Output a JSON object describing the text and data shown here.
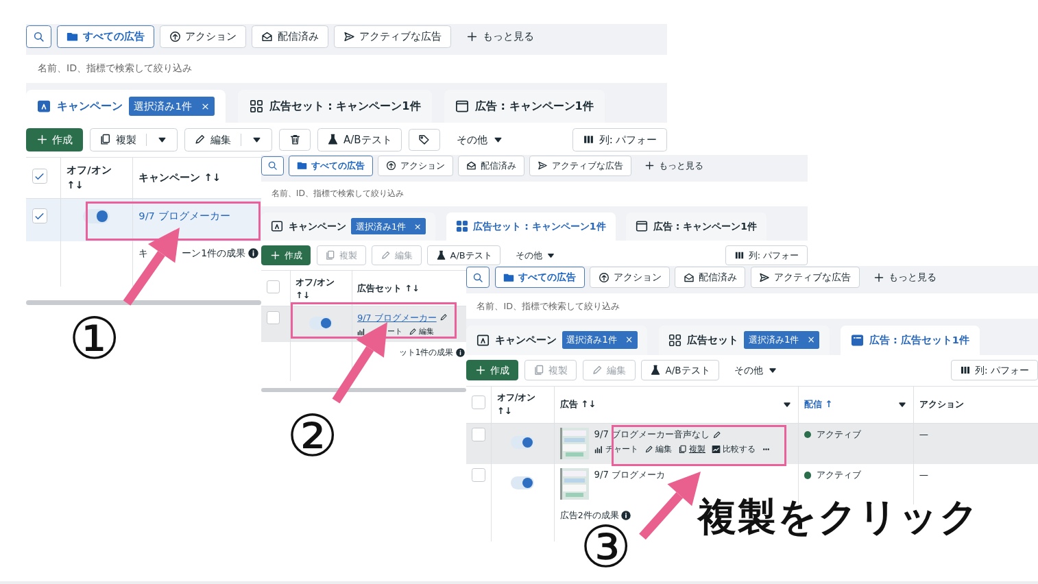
{
  "panels": [
    {
      "filters": [
        {
          "kind": "search"
        },
        {
          "kind": "all",
          "label": "すべての広告",
          "selected": true
        },
        {
          "kind": "action",
          "label": "アクション",
          "selected": false
        },
        {
          "kind": "delivered",
          "label": "配信済み",
          "selected": false
        },
        {
          "kind": "active",
          "label": "アクティブな広告",
          "selected": false
        },
        {
          "kind": "more",
          "label": "もっと見る"
        }
      ],
      "search": {
        "placeholder": "名前、ID、指標で検索して絞り込み"
      },
      "tabs": [
        {
          "kind": "campaign",
          "label": "キャンペーン",
          "badge": "選択済み1件",
          "close": "×",
          "selected": true
        },
        {
          "kind": "adset",
          "label": "広告セット : キャンペーン1件",
          "selected": false
        },
        {
          "kind": "ad",
          "label": "広告 : キャンペーン1件",
          "selected": false
        }
      ],
      "toolbar": [
        {
          "kind": "create",
          "label": "作成",
          "disabled": false
        },
        {
          "kind": "copy",
          "label": "複製",
          "split": true,
          "disabled": false
        },
        {
          "kind": "edit",
          "label": "編集",
          "split": true,
          "disabled": false
        },
        {
          "kind": "delete",
          "disabled": false
        },
        {
          "kind": "abtest",
          "label": "A/Bテスト",
          "disabled": false
        },
        {
          "kind": "tag",
          "disabled": false
        },
        {
          "kind": "other",
          "label": "その他",
          "disabled": false
        },
        {
          "kind": "columns",
          "label": "列: パフォー",
          "disabled": false
        }
      ],
      "table": {
        "checked": true,
        "columns": [
          {
            "kind": "toggle",
            "label": "オフ/オン ↑↓"
          },
          {
            "kind": "name",
            "label": "キャンペーン ↑↓"
          }
        ],
        "rows": [
          {
            "checked": true,
            "hovered": false,
            "on": true,
            "name": "9/7 ブログメーカー"
          }
        ],
        "summary": [
          "キ",
          "ーン1件の成果"
        ]
      }
    },
    {
      "filters": [
        {
          "kind": "search"
        },
        {
          "kind": "all",
          "label": "すべての広告",
          "selected": true
        },
        {
          "kind": "action",
          "label": "アクション",
          "selected": false
        },
        {
          "kind": "delivered",
          "label": "配信済み",
          "selected": false
        },
        {
          "kind": "active",
          "label": "アクティブな広告",
          "selected": false
        },
        {
          "kind": "more",
          "label": "もっと見る"
        }
      ],
      "search": {
        "placeholder": "名前、ID、指標で検索して絞り込み"
      },
      "tabs": [
        {
          "kind": "campaign",
          "label": "キャンペーン",
          "badge": "選択済み1件",
          "close": "×",
          "selected": false
        },
        {
          "kind": "adset",
          "label": "広告セット : キャンペーン1件",
          "selected": true
        },
        {
          "kind": "ad",
          "label": "広告 : キャンペーン1件",
          "selected": false
        }
      ],
      "toolbar": [
        {
          "kind": "create",
          "label": "作成",
          "disabled": false
        },
        {
          "kind": "copy",
          "label": "複製",
          "disabled": true
        },
        {
          "kind": "edit",
          "label": "編集",
          "disabled": true
        },
        {
          "kind": "abtest",
          "label": "A/Bテスト",
          "disabled": false
        },
        {
          "kind": "other",
          "label": "その他",
          "disabled": false
        },
        {
          "kind": "columns",
          "label": "列: パフォー",
          "disabled": false
        }
      ],
      "table": {
        "checked": false,
        "columns": [
          {
            "kind": "toggle",
            "label": "オフ/オン ↑↓"
          },
          {
            "kind": "name",
            "label": "広告セット ↑↓"
          }
        ],
        "rows": [
          {
            "checked": false,
            "hovered": true,
            "on": true,
            "name": "9/7 ブログメーカー",
            "actions": [
              {
                "kind": "chart",
                "label": "ート",
                "hovered": false
              },
              {
                "kind": "edit",
                "label": "編集",
                "hovered": false
              }
            ]
          }
        ],
        "summary": [
          "ット1件の成果"
        ]
      }
    },
    {
      "filters": [
        {
          "kind": "search"
        },
        {
          "kind": "all",
          "label": "すべての広告",
          "selected": true
        },
        {
          "kind": "action",
          "label": "アクション",
          "selected": false
        },
        {
          "kind": "delivered",
          "label": "配信済み",
          "selected": false
        },
        {
          "kind": "active",
          "label": "アクティブな広告",
          "selected": false
        },
        {
          "kind": "more",
          "label": "もっと見る"
        }
      ],
      "search": {
        "placeholder": "名前、ID、指標で検索して絞り込み"
      },
      "tabs": [
        {
          "kind": "campaign",
          "label": "キャンペーン",
          "badge": "選択済み1件",
          "close": "×",
          "selected": false
        },
        {
          "kind": "adset",
          "label": "広告セット",
          "badge": "選択済み1件",
          "close": "×",
          "selected": false
        },
        {
          "kind": "ad",
          "label": "広告 : 広告セット1件",
          "selected": true
        }
      ],
      "toolbar": [
        {
          "kind": "create",
          "label": "作成",
          "disabled": false
        },
        {
          "kind": "copy",
          "label": "複製",
          "disabled": true
        },
        {
          "kind": "edit",
          "label": "編集",
          "disabled": true
        },
        {
          "kind": "abtest",
          "label": "A/Bテスト",
          "disabled": false
        },
        {
          "kind": "other",
          "label": "その他",
          "disabled": false
        },
        {
          "kind": "columns",
          "label": "列: パフォー",
          "disabled": false
        }
      ],
      "table": {
        "checked": false,
        "columns": [
          {
            "kind": "toggle",
            "label": "オフ/オン ↑↓"
          },
          {
            "kind": "name",
            "label": "広告 ↑↓",
            "menu": true,
            "sorted": false
          },
          {
            "kind": "status",
            "label": "配信 ↑",
            "menu": true,
            "sorted": true
          },
          {
            "kind": "action",
            "label": "アクション",
            "sorted": false
          }
        ],
        "rows": [
          {
            "checked": false,
            "hovered": true,
            "on": true,
            "thumb": {
              "kind": "picture"
            },
            "name": "9/7 ブログメーカー音声なし",
            "actions": [
              {
                "kind": "chart",
                "label": "チャート",
                "hovered": false
              },
              {
                "kind": "edit",
                "label": "編集",
                "hovered": false
              },
              {
                "kind": "copy",
                "label": "複製",
                "hovered": true
              },
              {
                "kind": "compare",
                "label": "比較する",
                "hovered": false
              },
              {
                "kind": "dots"
              }
            ],
            "status": "アクティブ",
            "action": "—"
          },
          {
            "checked": false,
            "hovered": false,
            "on": true,
            "thumb": {
              "kind": "picture"
            },
            "name": "9/7 ブログメーカ",
            "status": "アクティブ",
            "action": "—"
          }
        ],
        "summary": [
          "広告2件の成果"
        ]
      }
    }
  ],
  "annotations": {
    "steps": [
      "①",
      "②",
      "③"
    ],
    "caption": "複製をクリック"
  }
}
